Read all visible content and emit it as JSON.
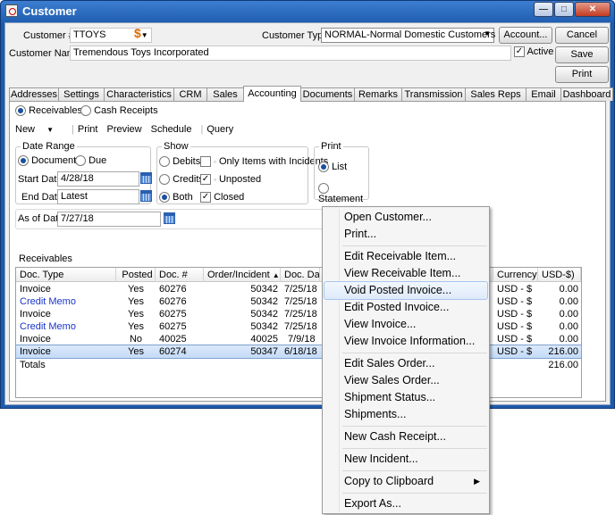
{
  "window": {
    "title": "Customer",
    "min_label": "—",
    "max_label": "□",
    "close_label": "✕"
  },
  "header": {
    "customer_num_label": "Customer #:",
    "customer_num_value": "TTOYS",
    "currency_symbol": "$",
    "customer_type_label": "Customer Type:",
    "customer_type_value": "NORMAL-Normal Domestic Customers",
    "account_button": "Account...",
    "customer_name_label": "Customer Name:",
    "customer_name_value": "Tremendous Toys Incorporated",
    "active_label": "Active",
    "active_checked": true,
    "cancel_button": "Cancel",
    "save_button": "Save",
    "print_button": "Print"
  },
  "tabs": [
    {
      "label": "Addresses"
    },
    {
      "label": "Settings"
    },
    {
      "label": "Characteristics"
    },
    {
      "label": "CRM"
    },
    {
      "label": "Sales"
    },
    {
      "label": "Accounting"
    },
    {
      "label": "Documents"
    },
    {
      "label": "Remarks"
    },
    {
      "label": "Transmission"
    },
    {
      "label": "Sales Reps"
    },
    {
      "label": "Email"
    },
    {
      "label": "Dashboard"
    }
  ],
  "accounting": {
    "mode_receivables": "Receivables",
    "mode_cash_receipts": "Cash Receipts",
    "toolbar": {
      "new": "New",
      "new_arrow": "▼",
      "print": "Print",
      "preview": "Preview",
      "schedule": "Schedule",
      "query": "Query"
    },
    "date_range": {
      "title": "Date Range",
      "document": "Document",
      "due": "Due",
      "start_label": "Start Date:",
      "start_value": "4/28/18",
      "end_label": "End Date:",
      "end_value": "Latest"
    },
    "show": {
      "title": "Show",
      "debits": "Debits",
      "credits": "Credits",
      "both": "Both",
      "only_items": "Only Items with Incidents",
      "unposted": "Unposted",
      "closed": "Closed"
    },
    "print": {
      "title": "Print",
      "list": "List",
      "statement": "Statement"
    },
    "as_of_label": "As of Date:",
    "as_of_value": "7/27/18",
    "receivables_label": "Receivables",
    "columns": [
      "Doc. Type",
      "Posted",
      "Doc. #",
      "Order/Incident",
      "Doc. Dat",
      "e",
      "Currency",
      "USD-$)"
    ],
    "sort_indicator": "▲",
    "rows": [
      {
        "type": "Invoice",
        "posted": "Yes",
        "doc": "60276",
        "order": "50342",
        "date": "7/25/18",
        "currency": "USD - $",
        "amount": "0.00",
        "link": false
      },
      {
        "type": "Credit Memo",
        "posted": "Yes",
        "doc": "60276",
        "order": "50342",
        "date": "7/25/18",
        "currency": "USD - $",
        "amount": "0.00",
        "link": true
      },
      {
        "type": "Invoice",
        "posted": "Yes",
        "doc": "60275",
        "order": "50342",
        "date": "7/25/18",
        "currency": "USD - $",
        "amount": "0.00",
        "link": false
      },
      {
        "type": "Credit Memo",
        "posted": "Yes",
        "doc": "60275",
        "order": "50342",
        "date": "7/25/18",
        "currency": "USD - $",
        "amount": "0.00",
        "link": true
      },
      {
        "type": "Invoice",
        "posted": "No",
        "doc": "40025",
        "order": "40025",
        "date": "7/9/18",
        "currency": "USD - $",
        "amount": "0.00",
        "link": false
      },
      {
        "type": "Invoice",
        "posted": "Yes",
        "doc": "60274",
        "order": "50347",
        "date": "6/18/18",
        "currency": "USD - $",
        "amount": "216.00",
        "link": false
      }
    ],
    "totals_label": "Totals",
    "totals_amount": "216.00"
  },
  "context_menu": {
    "items": [
      "Open Customer...",
      "Print...",
      "Edit Receivable Item...",
      "View Receivable Item...",
      "Void Posted Invoice...",
      "Edit Posted Invoice...",
      "View Invoice...",
      "View Invoice Information...",
      "Edit Sales Order...",
      "View Sales Order...",
      "Shipment Status...",
      "Shipments...",
      "New Cash Receipt...",
      "New Incident...",
      "Copy to Clipboard",
      "Export As..."
    ],
    "highlighted": "Void Posted Invoice...",
    "submenu_arrow": "▶"
  },
  "colors": {
    "titlebar": "#1f5eb0",
    "link": "#1a35c8",
    "selection": "#c4daf7"
  }
}
